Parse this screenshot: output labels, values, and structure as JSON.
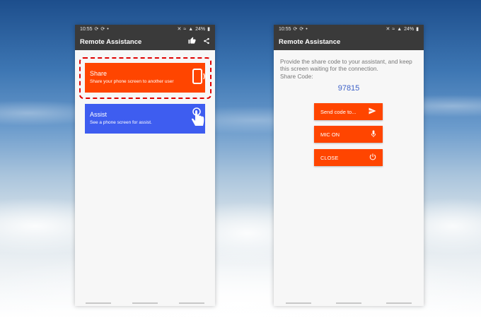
{
  "left_phone": {
    "status": {
      "time": "10:55",
      "battery": "24%"
    },
    "app_title": "Remote Assistance",
    "share_card": {
      "title": "Share",
      "description": "Share your phone screen to another user"
    },
    "assist_card": {
      "title": "Assist",
      "description": "See a phone screen for assist."
    }
  },
  "right_phone": {
    "status": {
      "time": "10:55",
      "battery": "24%"
    },
    "app_title": "Remote Assistance",
    "instructions": "Provide the share code to your assistant, and keep this screen waiting for the connection.",
    "share_code_label": "Share Code:",
    "share_code": "97815",
    "buttons": {
      "send": "Send code to...",
      "mic": "MIC ON",
      "close": "CLOSE"
    }
  },
  "colors": {
    "share": "#ff4500",
    "assist": "#3e5df0",
    "code": "#3e62c8",
    "highlight": "#e00000"
  },
  "icons": [
    "thumbs-up-icon",
    "share-icon",
    "phone-vibrate-icon",
    "tap-hand-icon",
    "send-icon",
    "microphone-icon",
    "power-icon"
  ]
}
